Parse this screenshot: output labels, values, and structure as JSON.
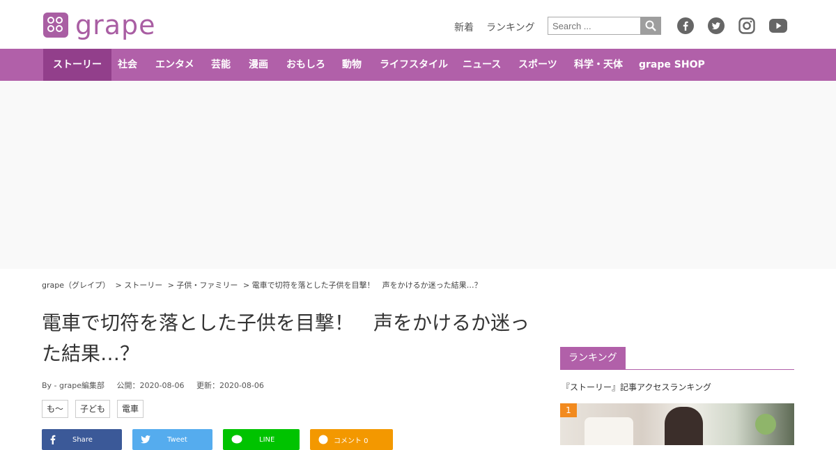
{
  "header": {
    "logo_text": "grape",
    "nav_new": "新着",
    "nav_ranking": "ランキング",
    "search_placeholder": "Search ...",
    "social": [
      "facebook-icon",
      "twitter-icon",
      "instagram-icon",
      "youtube-icon"
    ]
  },
  "navbar": {
    "items": [
      "ストーリー",
      "社会",
      "エンタメ",
      "芸能",
      "漫画",
      "おもしろ",
      "動物",
      "ライフスタイル",
      "ニュース",
      "スポーツ",
      "科学・天体",
      "grape SHOP"
    ],
    "active": "ストーリー"
  },
  "breadcrumb": [
    "grape（グレイプ）",
    "> ストーリー",
    "> 子供・ファミリー",
    "> 電車で切符を落とした子供を目撃！　声をかけるか迷った結果…？"
  ],
  "article": {
    "title": "電車で切符を落とした子供を目撃！　声をかけるか迷った結果…？",
    "author": "By - grape編集部",
    "published": "公開：2020-08-06",
    "updated": "更新：2020-08-06",
    "tags": [
      "も～",
      "子ども",
      "電車"
    ],
    "share": [
      {
        "label": "Share",
        "color": "#3b5998"
      },
      {
        "label": "Tweet",
        "color": "#55acee"
      },
      {
        "label": "LINE",
        "color": "#00c300"
      },
      {
        "label": "コメント 0",
        "color": "#f39800"
      }
    ]
  },
  "sidebar": {
    "ranking_tab": "ランキング",
    "ranking_subtitle": "『ストーリー』記事アクセスランキング",
    "first_rank": "1"
  },
  "colors": {
    "brand": "#b160a9",
    "brand_dark": "#923f8b",
    "rank_badge": "#f28a1e"
  }
}
